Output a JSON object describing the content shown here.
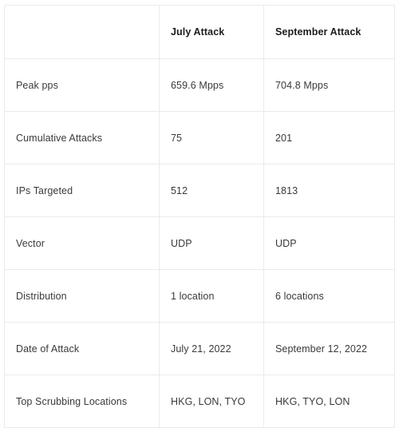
{
  "table": {
    "columns": [
      {
        "key": "metric",
        "label": ""
      },
      {
        "key": "july",
        "label": "July Attack"
      },
      {
        "key": "september",
        "label": "September Attack"
      }
    ],
    "rows": [
      {
        "metric": "Peak pps",
        "july": "659.6 Mpps",
        "september": "704.8 Mpps"
      },
      {
        "metric": "Cumulative Attacks",
        "july": "75",
        "september": "201"
      },
      {
        "metric": "IPs Targeted",
        "july": "512",
        "september": "1813"
      },
      {
        "metric": "Vector",
        "july": "UDP",
        "september": "UDP"
      },
      {
        "metric": "Distribution",
        "july": "1 location",
        "september": "6 locations"
      },
      {
        "metric": "Date of Attack",
        "july": "July 21, 2022",
        "september": "September 12, 2022"
      },
      {
        "metric": "Top Scrubbing Locations",
        "july": "HKG, LON, TYO",
        "september": "HKG, TYO, LON"
      }
    ]
  },
  "style": {
    "border_color": "#ebebeb",
    "header_text_color": "#1c1c1c",
    "body_text_color": "#3a3a3a",
    "background_color": "#ffffff"
  }
}
